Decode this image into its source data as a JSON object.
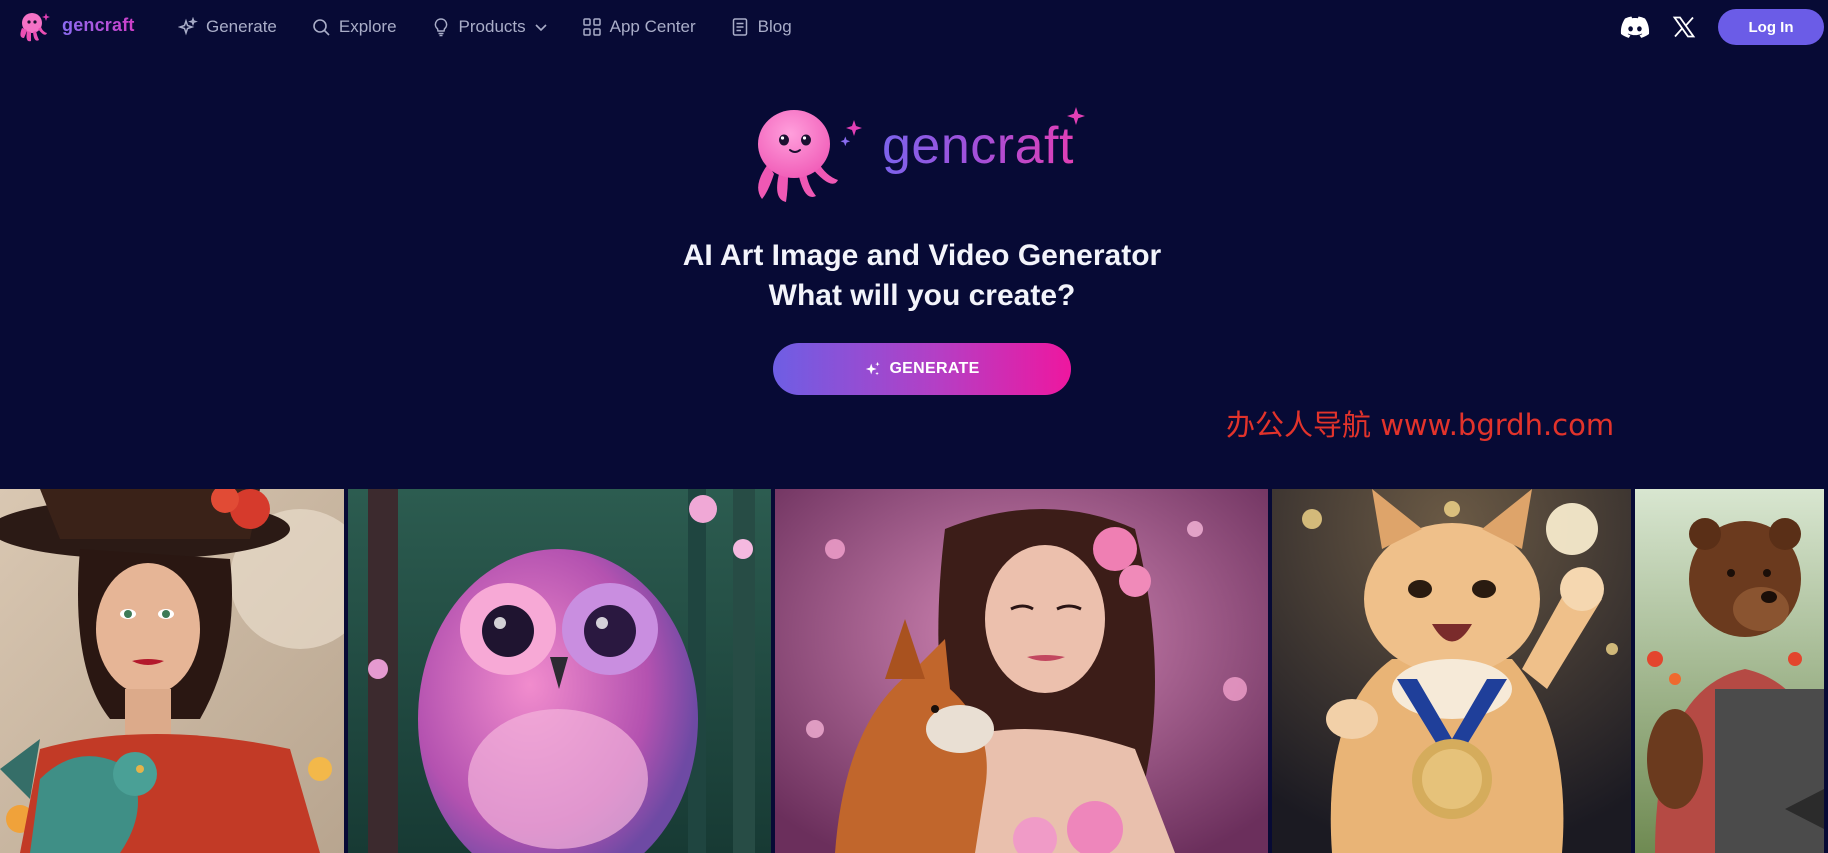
{
  "nav": {
    "brand": "gencraft",
    "items": [
      {
        "label": "Generate",
        "icon": "sparkles-icon"
      },
      {
        "label": "Explore",
        "icon": "search-icon"
      },
      {
        "label": "Products",
        "icon": "lightbulb-icon",
        "dropdown": true
      },
      {
        "label": "App Center",
        "icon": "apps-grid-icon"
      },
      {
        "label": "Blog",
        "icon": "document-icon"
      }
    ],
    "social": [
      "discord-icon",
      "x-icon"
    ],
    "login_label": "Log In"
  },
  "hero": {
    "brand": "gencraft",
    "title_line1": "AI Art Image and Video Generator",
    "title_line2": "What will you create?",
    "generate_label": "GENERATE"
  },
  "watermark": "办公人导航 www.bgrdh.com",
  "gallery": {
    "images": [
      "woman-with-dragon-image",
      "pink-owl-image",
      "woman-with-fox-image",
      "cat-with-medal-image",
      "bear-chef-image"
    ]
  },
  "colors": {
    "background": "#070a35",
    "accent": "#6b5ce7",
    "pink": "#ee179f",
    "nav_text": "#a9adc8",
    "watermark": "#e2332b"
  }
}
